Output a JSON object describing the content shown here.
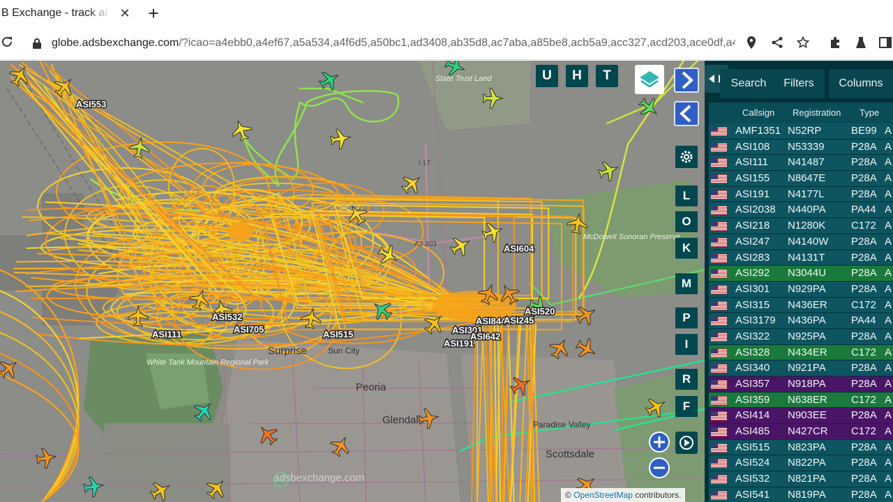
{
  "browser": {
    "tab_title": "B Exchange - track ai",
    "tab_close": "✕",
    "new_tab": "+",
    "url_host": "globe.adsbexchange.com",
    "url_rest": "/?icao=a4ebb0,a4ef67,a5a534,a4f6d5,a50bc1,ad3408,ab35d8,ac7aba,a85be8,acb5a9,acc327,acd203,ace0df,a4..."
  },
  "map": {
    "top_buttons": [
      "U",
      "H",
      "T"
    ],
    "side_buttons": [
      "L",
      "O",
      "K",
      "M",
      "P",
      "I",
      "R",
      "F"
    ],
    "flight_labels": [
      "ASI553",
      "ASI604",
      "ASI532",
      "ASI705",
      "ASI111",
      "ASI515",
      "ASI301",
      "ASI844",
      "ASI191",
      "ASI642",
      "ASI245",
      "ASI520"
    ],
    "places": [
      "Surprise",
      "Sun City",
      "Peoria",
      "Glendale",
      "Scottsdale",
      "Paradise Valley"
    ],
    "parks": [
      "White Tank Mountain Regional Park",
      "McDowell Sonoran Preserve",
      "State Trust Land"
    ],
    "watermark": "adsbexchange.com",
    "attribution_prefix": "©",
    "attribution_link": "OpenStreetMap",
    "attribution_suffix": "contributors.",
    "road_labels": [
      "I 17",
      "A2 303"
    ]
  },
  "panel": {
    "tabs": [
      "Search",
      "Filters",
      "Columns"
    ],
    "columns": [
      "Callsign",
      "Registration",
      "Type"
    ],
    "rows": [
      {
        "callsign": "AMF1351",
        "reg": "N52RP",
        "type": "BE99",
        "extra": "A",
        "hl": ""
      },
      {
        "callsign": "ASI108",
        "reg": "N53339",
        "type": "P28A",
        "extra": "A",
        "hl": ""
      },
      {
        "callsign": "ASI111",
        "reg": "N41487",
        "type": "P28A",
        "extra": "A",
        "hl": ""
      },
      {
        "callsign": "ASI155",
        "reg": "N8647E",
        "type": "P28A",
        "extra": "A",
        "hl": ""
      },
      {
        "callsign": "ASI191",
        "reg": "N4177L",
        "type": "P28A",
        "extra": "A",
        "hl": ""
      },
      {
        "callsign": "ASI2038",
        "reg": "N440PA",
        "type": "PA44",
        "extra": "A",
        "hl": ""
      },
      {
        "callsign": "ASI218",
        "reg": "N1280K",
        "type": "C172",
        "extra": "A",
        "hl": ""
      },
      {
        "callsign": "ASI247",
        "reg": "N4140W",
        "type": "P28A",
        "extra": "A",
        "hl": ""
      },
      {
        "callsign": "ASI283",
        "reg": "N4131T",
        "type": "P28A",
        "extra": "A",
        "hl": ""
      },
      {
        "callsign": "ASI292",
        "reg": "N3044U",
        "type": "P28A",
        "extra": "A",
        "hl": "green"
      },
      {
        "callsign": "ASI301",
        "reg": "N929PA",
        "type": "P28A",
        "extra": "A",
        "hl": ""
      },
      {
        "callsign": "ASI315",
        "reg": "N436ER",
        "type": "C172",
        "extra": "A",
        "hl": ""
      },
      {
        "callsign": "ASI3179",
        "reg": "N436PA",
        "type": "PA44",
        "extra": "A",
        "hl": ""
      },
      {
        "callsign": "ASI322",
        "reg": "N925PA",
        "type": "P28A",
        "extra": "A",
        "hl": ""
      },
      {
        "callsign": "ASI328",
        "reg": "N434ER",
        "type": "C172",
        "extra": "A",
        "hl": "green"
      },
      {
        "callsign": "ASI340",
        "reg": "N921PA",
        "type": "P28A",
        "extra": "A",
        "hl": ""
      },
      {
        "callsign": "ASI357",
        "reg": "N918PA",
        "type": "P28A",
        "extra": "A",
        "hl": "purple"
      },
      {
        "callsign": "ASI359",
        "reg": "N638ER",
        "type": "C172",
        "extra": "A",
        "hl": "green"
      },
      {
        "callsign": "ASI414",
        "reg": "N903EE",
        "type": "P28A",
        "extra": "A",
        "hl": "purple"
      },
      {
        "callsign": "ASI485",
        "reg": "N427CR",
        "type": "C172",
        "extra": "A",
        "hl": "purple"
      },
      {
        "callsign": "ASI515",
        "reg": "N823PA",
        "type": "P28A",
        "extra": "A",
        "hl": ""
      },
      {
        "callsign": "ASI524",
        "reg": "N822PA",
        "type": "P28A",
        "extra": "A",
        "hl": ""
      },
      {
        "callsign": "ASI532",
        "reg": "N821PA",
        "type": "P28A",
        "extra": "A",
        "hl": ""
      },
      {
        "callsign": "ASI541",
        "reg": "N819PA",
        "type": "P28A",
        "extra": "A",
        "hl": ""
      }
    ]
  },
  "colors": {
    "panel_bg": "#00323a",
    "row_default": "#0d5560",
    "row_green": "#1a7a3c",
    "row_purple": "#4a1566",
    "button_teal": "#00474f",
    "track_orange": "#f7a21a",
    "track_yellow": "#f5d22c",
    "track_green": "#8fe34d"
  }
}
